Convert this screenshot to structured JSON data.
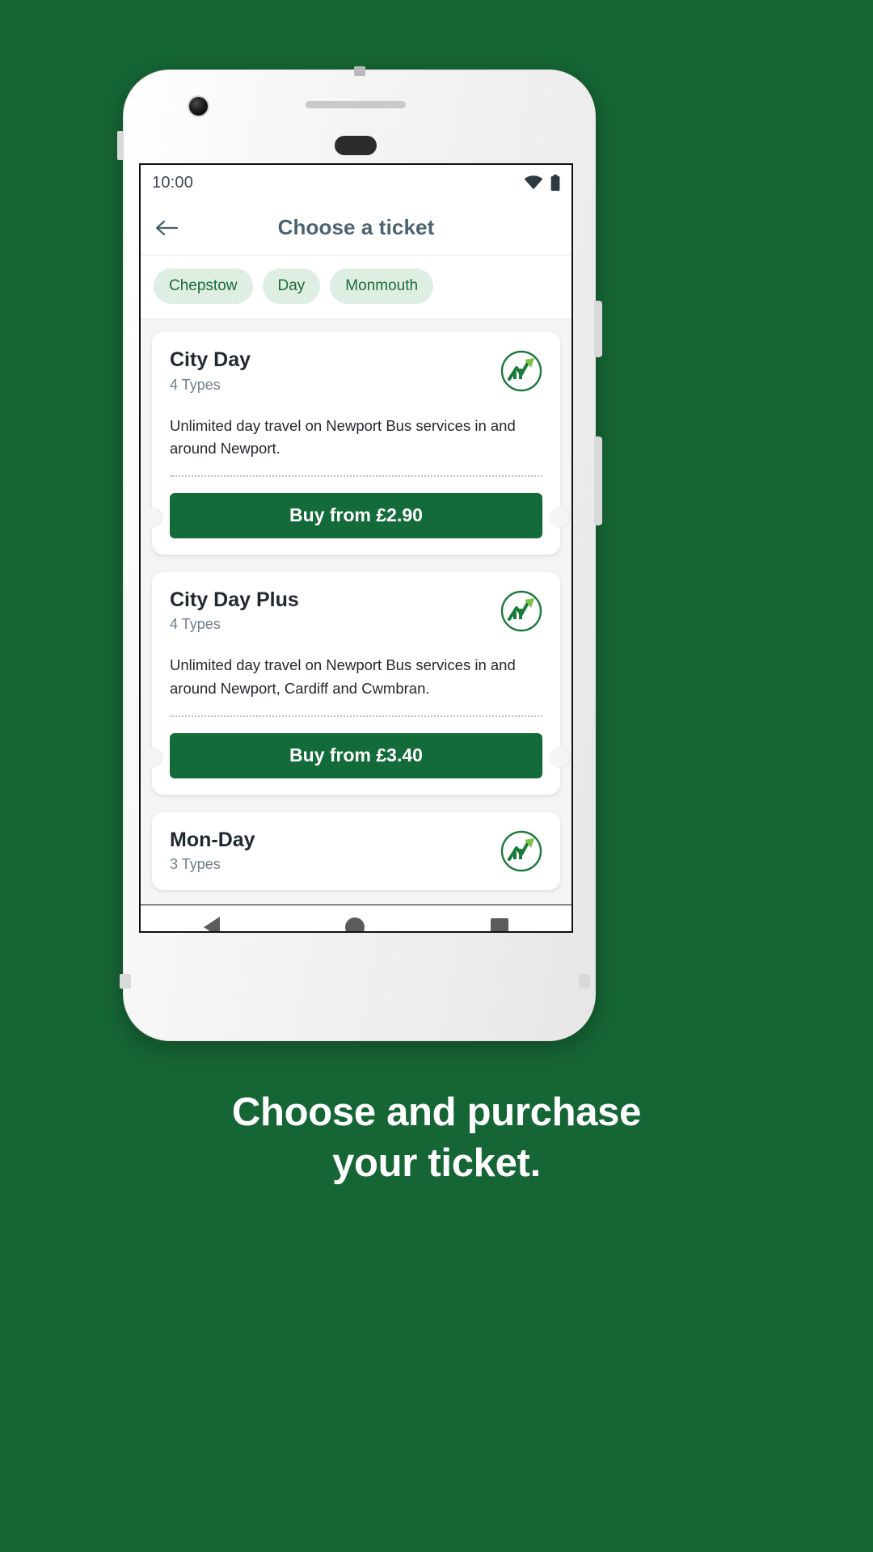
{
  "status_bar": {
    "time": "10:00",
    "wifi_icon": "wifi-icon",
    "battery_icon": "battery-icon"
  },
  "app_bar": {
    "back_icon": "back-arrow-icon",
    "title": "Choose a ticket"
  },
  "filters": {
    "chips": [
      {
        "label": "Chepstow"
      },
      {
        "label": "Day"
      },
      {
        "label": "Monmouth"
      }
    ]
  },
  "tickets": [
    {
      "title": "City Day",
      "types": "4 Types",
      "description": "Unlimited day travel on Newport Bus services in and around Newport.",
      "buy_label": "Buy from £2.90",
      "logo_icon": "newport-bus-logo-icon"
    },
    {
      "title": "City Day Plus",
      "types": "4 Types",
      "description": "Unlimited day travel on Newport Bus services in and around Newport, Cardiff and Cwmbran.",
      "buy_label": "Buy from £3.40",
      "logo_icon": "newport-bus-logo-icon"
    },
    {
      "title": "Mon-Day",
      "types": "3 Types",
      "description": "",
      "buy_label": "",
      "logo_icon": "newport-bus-logo-icon"
    }
  ],
  "nav_bar": {
    "back_icon": "android-back-icon",
    "home_icon": "android-home-icon",
    "recents_icon": "android-recents-icon"
  },
  "caption": {
    "line1": "Choose and purchase",
    "line2": "your ticket."
  },
  "colors": {
    "background": "#166534",
    "brand_green": "#146b3a",
    "chip_bg": "#dfeee3",
    "chip_text": "#1b6b39",
    "title_slate": "#4b6370"
  }
}
